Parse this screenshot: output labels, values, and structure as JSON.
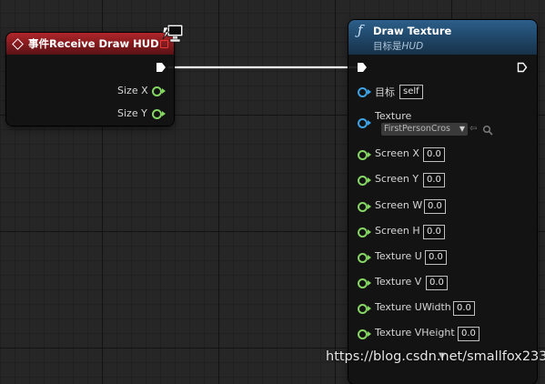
{
  "event_node": {
    "title": "事件Receive Draw HUD",
    "outputs": [
      {
        "label": "Size X"
      },
      {
        "label": "Size Y"
      }
    ]
  },
  "draw_node": {
    "title": "Draw Texture",
    "subtitle_prefix": "目标是",
    "subtitle_target": "HUD",
    "target": {
      "label": "目标",
      "value": "self"
    },
    "texture": {
      "label": "Texture",
      "value": "FirstPersonCros"
    },
    "params": [
      {
        "label": "Screen X",
        "value": "0.0"
      },
      {
        "label": "Screen Y",
        "value": "0.0"
      },
      {
        "label": "Screen W",
        "value": "0.0"
      },
      {
        "label": "Screen H",
        "value": "0.0"
      },
      {
        "label": "Texture U",
        "value": "0.0"
      },
      {
        "label": "Texture V",
        "value": "0.0"
      },
      {
        "label": "Texture UWidth",
        "value": "0.0"
      },
      {
        "label": "Texture VHeight",
        "value": "0.0"
      }
    ]
  },
  "watermark": "https://blog.csdn.net/smallfox233",
  "colors": {
    "event_header": "#a82428",
    "function_header": "#234d70",
    "float_pin": "#86d664",
    "object_pin": "#3ea2e6",
    "exec_wire": "#ffffff"
  }
}
